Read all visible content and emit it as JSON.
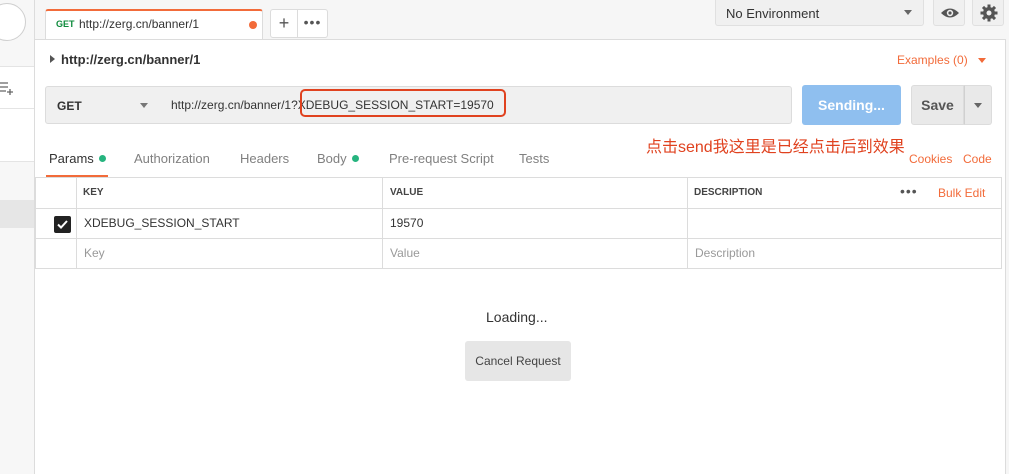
{
  "tabs": [
    {
      "method": "GET",
      "url": "http://zerg.cn/banner/1",
      "unsaved": true
    }
  ],
  "tab_actions": {
    "new_tab": "+",
    "more": "•••"
  },
  "environment": {
    "selected": "No Environment"
  },
  "request": {
    "name": "http://zerg.cn/banner/1",
    "examples_label": "Examples (0)",
    "method": "GET",
    "url": "http://zerg.cn/banner/1?XDEBUG_SESSION_START=19570",
    "send_label": "Sending...",
    "save_label": "Save"
  },
  "annotation": "点击send我这里是已经点击后到效果",
  "request_tabs": [
    {
      "label": "Params",
      "active": true,
      "dot": true
    },
    {
      "label": "Authorization",
      "active": false,
      "dot": false
    },
    {
      "label": "Headers",
      "active": false,
      "dot": false
    },
    {
      "label": "Body",
      "active": false,
      "dot": true
    },
    {
      "label": "Pre-request Script",
      "active": false,
      "dot": false
    },
    {
      "label": "Tests",
      "active": false,
      "dot": false
    }
  ],
  "links": {
    "cookies": "Cookies",
    "code": "Code"
  },
  "params": {
    "headers": {
      "key": "KEY",
      "value": "VALUE",
      "description": "DESCRIPTION"
    },
    "bulk_edit": "Bulk Edit",
    "rows": [
      {
        "checked": true,
        "key": "XDEBUG_SESSION_START",
        "value": "19570",
        "description": ""
      }
    ],
    "placeholders": {
      "key": "Key",
      "value": "Value",
      "description": "Description"
    }
  },
  "response": {
    "status": "Loading...",
    "cancel_label": "Cancel Request"
  },
  "colors": {
    "accent": "#f26b3a",
    "send_button": "#8fbfef",
    "annotation": "#e0421f",
    "method_get": "#0c8a3b",
    "tab_dot": "#26b47f"
  },
  "icons": [
    "new-collection-icon",
    "eye-icon",
    "gear-icon",
    "checkbox-checked-icon",
    "chevron-right-icon",
    "chevron-down-icon"
  ]
}
